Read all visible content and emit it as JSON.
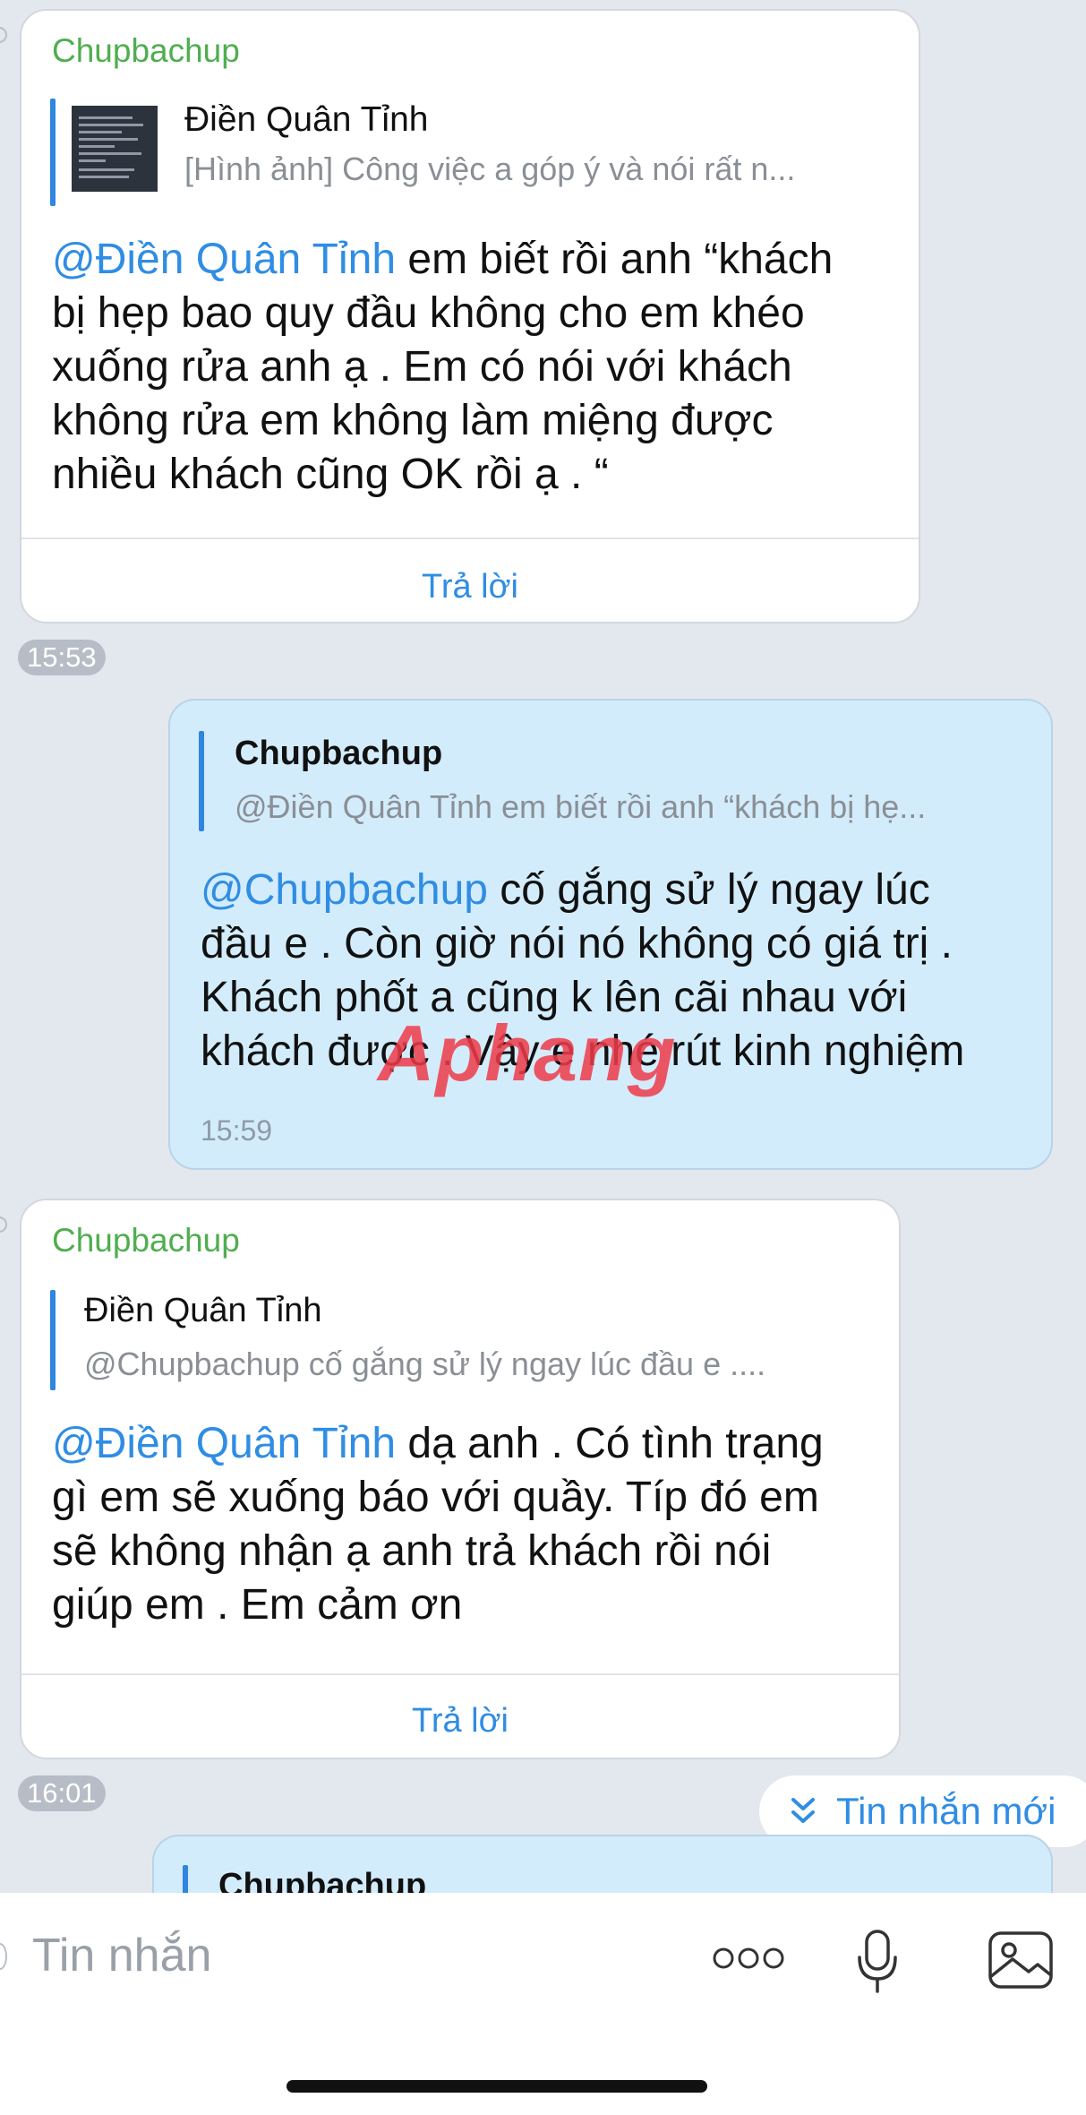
{
  "messages": [
    {
      "sender": "Chupbachup",
      "quote": {
        "name": "Điền Quân Tỉnh",
        "snippet": "[Hình ảnh] Công việc a góp ý và nói rất n..."
      },
      "mention": "@Điền Quân Tỉnh",
      "lines": [
        " em biết rồi anh “khách",
        "bị hẹp bao quy đầu không cho em khéo",
        "xuống rửa anh ạ . Em có nói với khách",
        "không rửa em không làm miệng được",
        "nhiều khách cũng OK rồi ạ . “"
      ],
      "reply_label": "Trả lời",
      "time": "15:53"
    },
    {
      "quote": {
        "name": "Chupbachup",
        "snippet": "@Điền Quân Tỉnh em biết rồi anh “khách bị hẹ..."
      },
      "mention": "@Chupbachup",
      "lines": [
        " cố gắng sử lý ngay lúc",
        "đầu e . Còn giờ nói nó không có giá trị .",
        "Khách phốt a cũng k lên cãi nhau với",
        "khách được . Vậy e nhé rút kinh nghiệm"
      ],
      "time": "15:59"
    },
    {
      "sender": "Chupbachup",
      "quote": {
        "name": "Điền Quân Tỉnh",
        "snippet": "@Chupbachup cố gắng sử lý ngay lúc đầu e ...."
      },
      "mention": "@Điền Quân Tỉnh",
      "lines": [
        " dạ anh . Có tình trạng",
        "gì em sẽ xuống báo với quầy. Típ đó em",
        "sẽ không nhận ạ anh trả khách rồi nói",
        "giúp em . Em cảm ơn"
      ],
      "reply_label": "Trả lời",
      "time": "16:01"
    },
    {
      "quote": {
        "name": "Chupbachup"
      }
    }
  ],
  "new_messages_label": "Tin nhắn mới",
  "watermark": "Aphang",
  "input": {
    "placeholder": "Tin nhắn"
  },
  "colors": {
    "accent": "#2f8de4",
    "sender": "#4fae4f",
    "outgoing_bg": "#d3ecfb",
    "chat_bg": "#e3e8ef"
  }
}
